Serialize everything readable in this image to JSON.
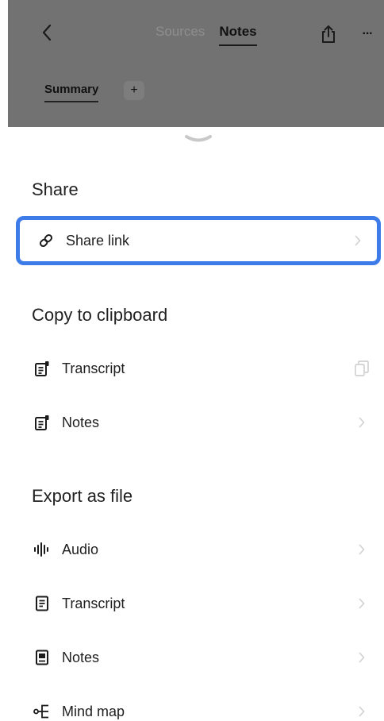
{
  "header": {
    "tabs": [
      {
        "label": "Sources",
        "active": false
      },
      {
        "label": "Notes",
        "active": true
      }
    ],
    "note_tab": "Summary",
    "add_note_label": "+",
    "more_label": "···"
  },
  "sheet": {
    "share": {
      "title": "Share",
      "items": [
        {
          "label": "Share link",
          "icon": "link-icon",
          "trailing": "chevron-right-icon",
          "highlighted": true
        }
      ]
    },
    "clipboard": {
      "title": "Copy to clipboard",
      "items": [
        {
          "label": "Transcript",
          "icon": "transcript-icon",
          "trailing": "copy-icon"
        },
        {
          "label": "Notes",
          "icon": "notes-icon",
          "trailing": "chevron-right-icon"
        }
      ]
    },
    "export": {
      "title": "Export as file",
      "items": [
        {
          "label": "Audio",
          "icon": "audio-waveform-icon",
          "trailing": "chevron-right-icon"
        },
        {
          "label": "Transcript",
          "icon": "document-icon",
          "trailing": "chevron-right-icon"
        },
        {
          "label": "Notes",
          "icon": "notes-file-icon",
          "trailing": "chevron-right-icon"
        },
        {
          "label": "Mind map",
          "icon": "mind-map-icon",
          "trailing": "chevron-right-icon"
        }
      ]
    }
  },
  "colors": {
    "highlight": "#3d7be8",
    "dim_overlay": "#727272"
  }
}
